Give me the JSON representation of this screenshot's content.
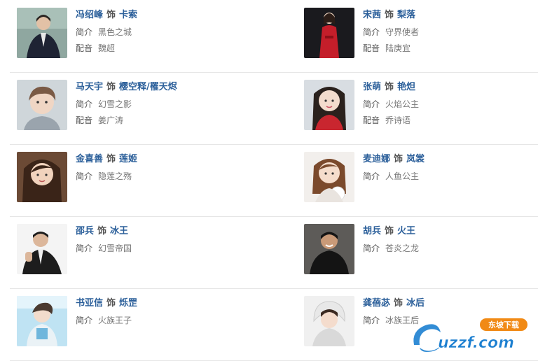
{
  "labels": {
    "verb": "饰",
    "intro": "简介",
    "dub": "配音"
  },
  "cast": [
    {
      "actor": "冯绍峰",
      "role": "卡索",
      "intro": "黑色之城",
      "dub": "魏超"
    },
    {
      "actor": "宋茜",
      "role": "梨落",
      "intro": "守界使者",
      "dub": "陆庚宜"
    },
    {
      "actor": "马天宇",
      "role": "樱空释/罹天烬",
      "intro": "幻雪之影",
      "dub": "姜广涛"
    },
    {
      "actor": "张萌",
      "role": "艳炟",
      "intro": "火焰公主",
      "dub": "乔诗语"
    },
    {
      "actor": "金喜善",
      "role": "莲姬",
      "intro": "隐莲之殇"
    },
    {
      "actor": "麦迪娜",
      "role": "岚裳",
      "intro": "人鱼公主"
    },
    {
      "actor": "邵兵",
      "role": "冰王",
      "intro": "幻雪帝国"
    },
    {
      "actor": "胡兵",
      "role": "火王",
      "intro": "苍炎之龙"
    },
    {
      "actor": "书亚信",
      "role": "烁罡",
      "intro": "火族王子"
    },
    {
      "actor": "龚蓓苾",
      "role": "冰后",
      "intro": "冰族王后"
    }
  ],
  "watermark": {
    "brand": "uzzf.com",
    "badge": "东坡下载"
  },
  "colors": {
    "name_blue": "#2b5f9a",
    "divider": "#e6e6e6",
    "watermark_blue": "#1c7fd0",
    "watermark_orange": "#f18a16"
  }
}
